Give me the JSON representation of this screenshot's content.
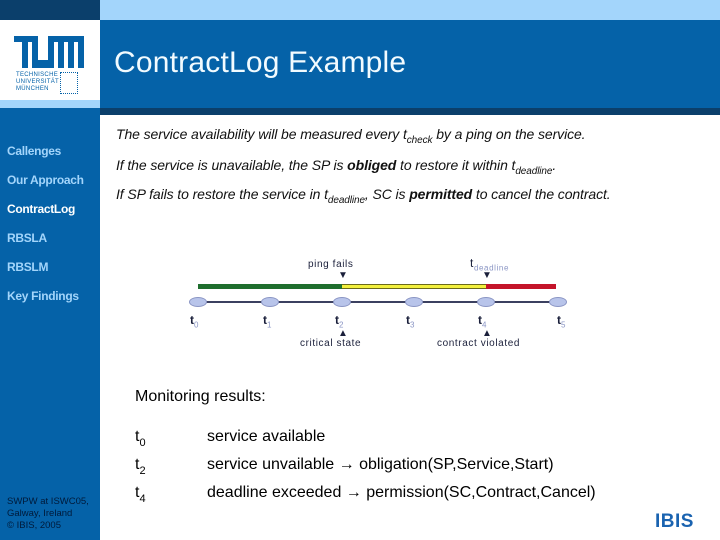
{
  "header": {
    "title": "ContractLog Example"
  },
  "logo": {
    "university_lines": [
      "TECHNISCHE",
      "UNIVERSITÄT",
      "MÜNCHEN"
    ],
    "footer_brand": "IBIS"
  },
  "sidebar": {
    "items": [
      {
        "label": "Callenges",
        "active": false
      },
      {
        "label": "Our Approach",
        "active": false
      },
      {
        "label": "ContractLog",
        "active": true
      },
      {
        "label": "RBSLA",
        "active": false
      },
      {
        "label": "RBSLM",
        "active": false
      },
      {
        "label": "Key Findings",
        "active": false
      }
    ],
    "footer": [
      "SWPW at ISWC05,",
      "Galway, Ireland",
      "© IBIS, 2005"
    ]
  },
  "bullets": {
    "b1": {
      "pre": "The service availability will be measured every t",
      "sub": "check",
      "post": " by a ping on the service."
    },
    "b2": {
      "pre": "If the service is unavailable, the SP is ",
      "bold": "obliged",
      "mid": " to restore it within t",
      "sub": "deadline",
      "post": "."
    },
    "b3": {
      "pre": "If SP fails to restore the service in t",
      "sub": "deadline",
      "mid": ", SC is ",
      "bold": "permitted",
      "post": " to cancel the contract."
    }
  },
  "timeline": {
    "segments": [
      {
        "state": "available",
        "color": "#1f6e2e"
      },
      {
        "state": "critical",
        "color": "#f2ef3c"
      },
      {
        "state": "violated",
        "color": "#c4142a"
      }
    ],
    "points": [
      {
        "t": "t",
        "sub": "0"
      },
      {
        "t": "t",
        "sub": "1"
      },
      {
        "t": "t",
        "sub": "2"
      },
      {
        "t": "t",
        "sub": "3"
      },
      {
        "t": "t",
        "sub": "4"
      },
      {
        "t": "t",
        "sub": "5"
      }
    ],
    "top_annotations": {
      "ping_fails": "ping fails",
      "deadline_t": "t",
      "deadline_sub": "deadline"
    },
    "bottom_annotations": {
      "critical_state": "critical state",
      "contract_violated": "contract violated"
    }
  },
  "monitoring": {
    "title": "Monitoring results:",
    "rows": [
      {
        "t": "t",
        "sub": "0",
        "desc": "service available"
      },
      {
        "t": "t",
        "sub": "2",
        "desc": "service unvailable → obligation(SP,Service,Start)"
      },
      {
        "t": "t",
        "sub": "4",
        "desc": "deadline exceeded → permission(SC,Contract,Cancel)"
      }
    ]
  }
}
